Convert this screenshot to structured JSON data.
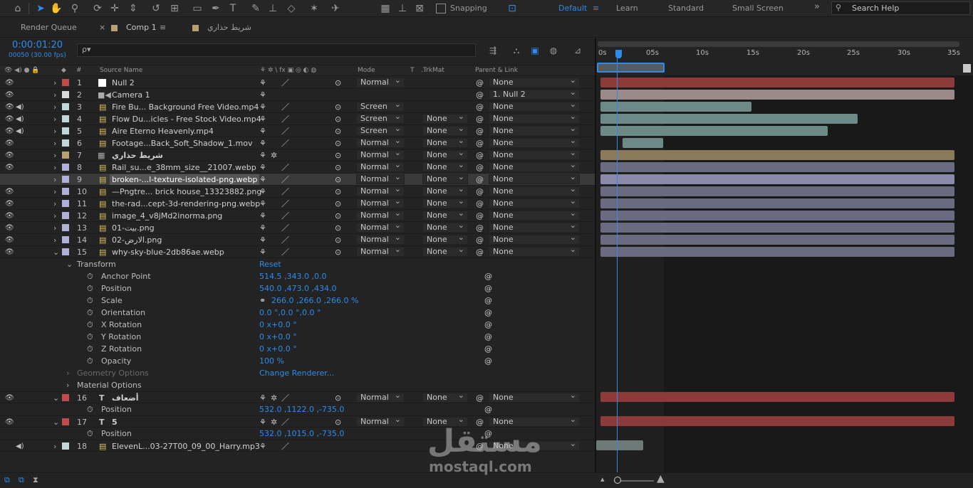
{
  "toolbar": {
    "snapping_label": "Snapping",
    "workspaces": [
      "Default",
      "Learn",
      "Standard",
      "Small Screen"
    ],
    "search_placeholder": "Search Help",
    "more": "»"
  },
  "panel_tabs": [
    {
      "label": "Render Queue"
    },
    {
      "label": "Comp 1"
    },
    {
      "label": "شريط حذاري"
    }
  ],
  "composition": {
    "timecode": "0:00:01:20",
    "frames": "00050 (30.00 fps)",
    "search_placeholder": "ρ▾"
  },
  "columns": {
    "hash": "#",
    "source_name": "Source Name",
    "switches": "⚘ ✲ \\ fx ▣ ◎ ◐ ◍",
    "mode": "Mode",
    "t": "T",
    "trkmat": ".TrkMat",
    "parent": "Parent & Link"
  },
  "layers": [
    {
      "num": "1",
      "name": "Null 2",
      "color": "#c14a4a",
      "mode": "Normal",
      "trkmat": "",
      "parent": "None",
      "audio": false
    },
    {
      "num": "2",
      "name": "Camera 1",
      "color": "#d9d9d9",
      "mode": "",
      "trkmat": "",
      "parent": "1. Null 2",
      "audio": false
    },
    {
      "num": "3",
      "name": "Fire Bu... Background Free Video.mp4",
      "color": "#c0d8d8",
      "mode": "Screen",
      "trkmat": "",
      "parent": "None",
      "audio": true
    },
    {
      "num": "4",
      "name": "Flow Du...icles - Free Stock Video.mp4",
      "color": "#c0d8d8",
      "mode": "Screen",
      "trkmat": "None",
      "parent": "None",
      "audio": true
    },
    {
      "num": "5",
      "name": "Aire Eterno Heavenly.mp4",
      "color": "#c0d8d8",
      "mode": "Screen",
      "trkmat": "None",
      "parent": "None",
      "audio": true
    },
    {
      "num": "6",
      "name": "Footage...Back_Soft_Shadow_1.mov",
      "color": "#c0d8d8",
      "mode": "Normal",
      "trkmat": "None",
      "parent": "None",
      "audio": false
    },
    {
      "num": "7",
      "name": "شريط حذاري",
      "color": "#b8a070",
      "mode": "Normal",
      "trkmat": "None",
      "parent": "None",
      "audio": false
    },
    {
      "num": "8",
      "name": "Rail_su...e_38mm_size__21007.webp",
      "color": "#b0b0d8",
      "mode": "Normal",
      "trkmat": "None",
      "parent": "None",
      "audio": false
    },
    {
      "num": "9",
      "name": "broken-...l-texture-isolated-png.webp",
      "color": "#b0b0d8",
      "mode": "Normal",
      "trkmat": "None",
      "parent": "None",
      "audio": false
    },
    {
      "num": "10",
      "name": "—Pngtre... brick house_13323882.png",
      "color": "#b0b0d8",
      "mode": "Normal",
      "trkmat": "None",
      "parent": "None",
      "audio": false
    },
    {
      "num": "11",
      "name": "the-rad...cept-3d-rendering-png.webp",
      "color": "#b0b0d8",
      "mode": "Normal",
      "trkmat": "None",
      "parent": "None",
      "audio": false
    },
    {
      "num": "12",
      "name": "image_4_v8jMd2inorma.png",
      "color": "#b0b0d8",
      "mode": "Normal",
      "trkmat": "None",
      "parent": "None",
      "audio": false
    },
    {
      "num": "13",
      "name": "01-بيت.png",
      "color": "#b0b0d8",
      "mode": "Normal",
      "trkmat": "None",
      "parent": "None",
      "audio": false
    },
    {
      "num": "14",
      "name": "02-الارض.png",
      "color": "#b0b0d8",
      "mode": "Normal",
      "trkmat": "None",
      "parent": "None",
      "audio": false
    },
    {
      "num": "15",
      "name": "why-sky-blue-2db86ae.webp",
      "color": "#b0b0d8",
      "mode": "Normal",
      "trkmat": "None",
      "parent": "None",
      "audio": false
    }
  ],
  "transform": {
    "group": "Transform",
    "reset": "Reset",
    "props": [
      {
        "name": "Anchor Point",
        "value": "514.5 ,343.0 ,0.0"
      },
      {
        "name": "Position",
        "value": "540.0 ,473.0 ,434.0"
      },
      {
        "name": "Scale",
        "value": "266.0 ,266.0 ,266.0 %"
      },
      {
        "name": "Orientation",
        "value": "0.0 °,0.0 °,0.0 °"
      },
      {
        "name": "X Rotation",
        "value": "0 x+0.0 °"
      },
      {
        "name": "Y Rotation",
        "value": "0 x+0.0 °"
      },
      {
        "name": "Z Rotation",
        "value": "0 x+0.0 °"
      },
      {
        "name": "Opacity",
        "value": "100 %"
      }
    ],
    "geometry": "Geometry Options",
    "change_renderer": "Change Renderer...",
    "material": "Material Options"
  },
  "text_layers": [
    {
      "num": "16",
      "name": "أضعاف",
      "color": "#c14a4a",
      "mode": "Normal",
      "trkmat": "None",
      "parent": "None",
      "prop": "Position",
      "value": "532.0 ,1122.0 ,-735.0"
    },
    {
      "num": "17",
      "name": "5",
      "color": "#c14a4a",
      "mode": "Normal",
      "trkmat": "None",
      "parent": "None",
      "prop": "Position",
      "value": "532.0 ,1015.0 ,-735.0"
    }
  ],
  "audio_layer": {
    "num": "18",
    "name": "ElevenL...03-27T00_09_00_Harry.mp3",
    "color": "#c0d8d8",
    "parent": "None"
  },
  "ruler_ticks": [
    "0s",
    "05s",
    "10s",
    "15s",
    "20s",
    "25s",
    "30s",
    "35s"
  ],
  "watermark": {
    "ar": "مستقل",
    "en": "mostaql.com"
  },
  "colors": {
    "accent": "#2d8ceb",
    "red": "#8c3a3a",
    "teal": "#6e8a88",
    "tan": "#8a7a5a",
    "lavender": "#6a6a8a"
  }
}
